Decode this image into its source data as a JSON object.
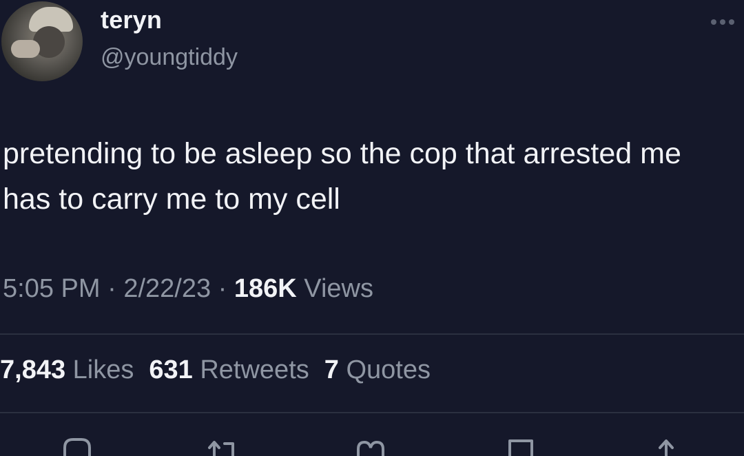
{
  "user": {
    "display_name": "teryn",
    "handle": "@youngtiddy",
    "avatar_icon": "profile-photo"
  },
  "tweet": {
    "text_line1": "pretending to be asleep so the cop that arrested me",
    "text_line2": "has to carry me to my cell"
  },
  "meta": {
    "time": "5:05 PM",
    "separator": " · ",
    "date": "2/22/23",
    "views_count": "186K",
    "views_label": "Views"
  },
  "stats": {
    "likes_count": "7,843",
    "likes_label": "Likes",
    "retweets_count": "631",
    "retweets_label": "Retweets",
    "quotes_count": "7",
    "quotes_label": "Quotes"
  },
  "actions": {
    "icons": [
      "reply-icon",
      "retweet-icon",
      "like-icon",
      "bookmark-icon",
      "share-icon"
    ]
  },
  "colors": {
    "background": "#15182a",
    "primary_text": "#f2f3f6",
    "secondary_text": "#8f96a3",
    "divider": "#2b3040"
  }
}
